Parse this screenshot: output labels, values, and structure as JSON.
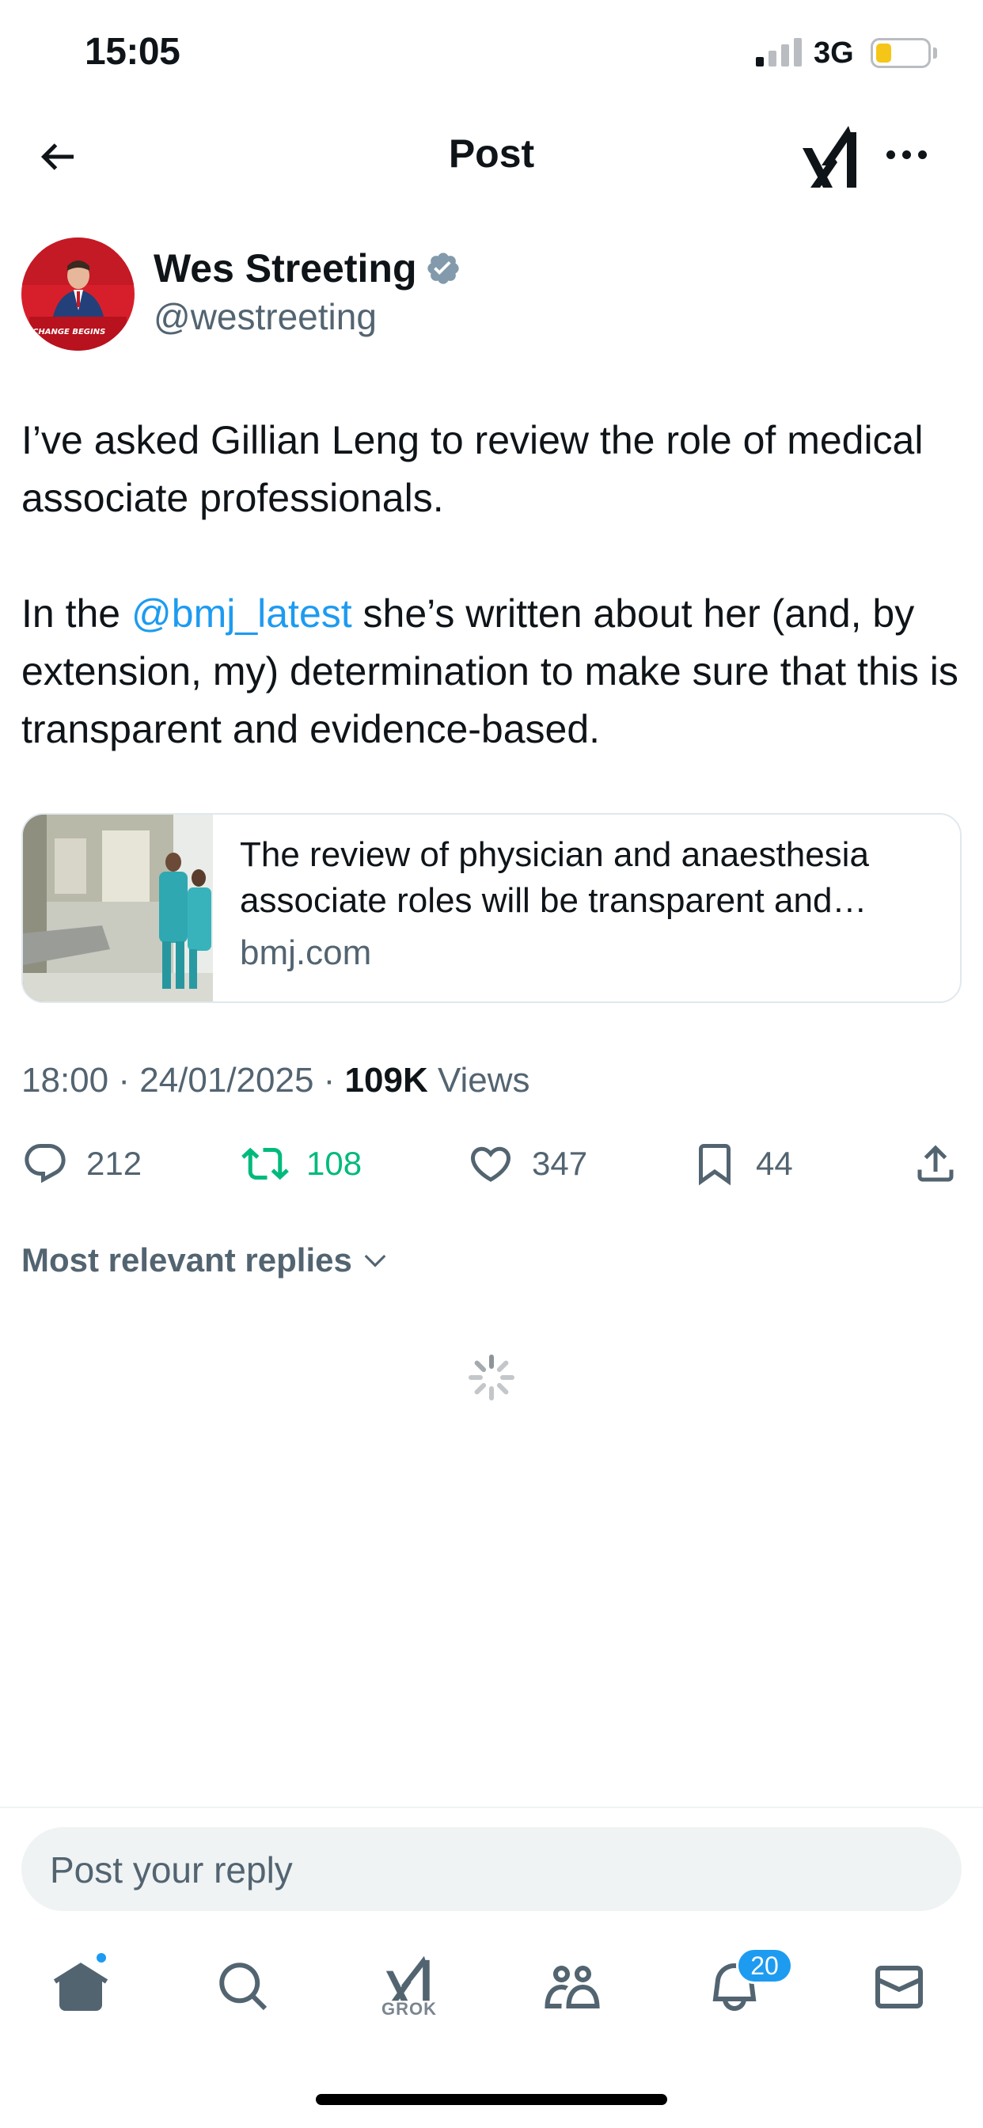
{
  "status_bar": {
    "time": "15:05",
    "network": "3G",
    "battery_level": 0.3
  },
  "header": {
    "title": "Post",
    "back_icon": "arrow-left-icon",
    "grok_icon": "grok-icon",
    "more_icon": "more-horizontal-icon"
  },
  "post": {
    "author": {
      "name": "Wes Streeting",
      "handle": "@westreeting",
      "verified": true,
      "avatar_podium_text": "CHANGE BEGINS"
    },
    "text": {
      "paragraph_1": "I’ve asked Gillian Leng to review the role of medical associate professionals.",
      "paragraph_2_before": "In the ",
      "mention": "@bmj_latest",
      "paragraph_2_after": " she’s written about her (and, by extension, my) determination to make sure that this is transparent and evidence-based."
    },
    "link_card": {
      "title": "The review of physician and anaesthesia associate roles will be transparent and evidence-based",
      "domain": "bmj.com"
    },
    "meta": {
      "time": "18:00",
      "separator": " · ",
      "date": "24/01/2025",
      "views_count": "109K",
      "views_label": " Views"
    },
    "actions": {
      "replies": "212",
      "reposts": "108",
      "likes": "347",
      "bookmarks": "44"
    }
  },
  "replies": {
    "filter_label": "Most relevant replies"
  },
  "reply_bar": {
    "placeholder": "Post your reply"
  },
  "tabbar": {
    "grok_label": "GROK",
    "notifications_badge": "20"
  },
  "colors": {
    "accent": "#1d9bf0",
    "retweet_green": "#00ba7c",
    "secondary_text": "#536471",
    "battery": "#f5c518"
  }
}
